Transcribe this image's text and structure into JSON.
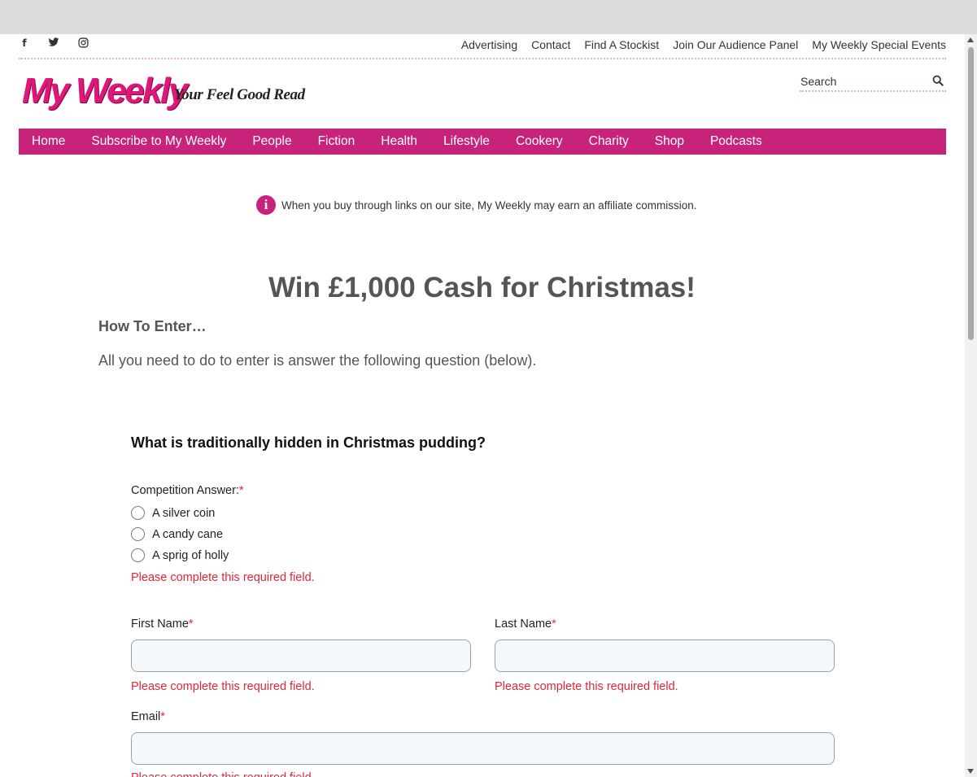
{
  "social": {
    "facebook_icon": "f",
    "twitter_icon": "twitter-bird",
    "instagram_icon": "instagram"
  },
  "toplinks": [
    "Advertising",
    "Contact",
    "Find A Stockist",
    "Join Our Audience Panel",
    "My Weekly Special Events"
  ],
  "brand": {
    "logo": "My Weekly",
    "tagline": "Your Feel Good Read",
    "accent_color": "#c8237b"
  },
  "search": {
    "placeholder": "Search"
  },
  "nav": [
    "Home",
    "Subscribe to My Weekly",
    "People",
    "Fiction",
    "Health",
    "Lifestyle",
    "Cookery",
    "Charity",
    "Shop",
    "Podcasts"
  ],
  "notice": {
    "icon": "i",
    "text": "When you buy through links on our site, My Weekly may earn an affiliate commission."
  },
  "article": {
    "title": "Win £1,000 Cash for Christmas!",
    "subheading": "How To Enter…",
    "intro": "All you need to do to enter is answer the following question (below)."
  },
  "form": {
    "question": "What is traditionally hidden in Christmas pudding?",
    "answer_label": "Competition Answer:",
    "required_mark": "*",
    "options": [
      "A silver coin",
      "A candy cane",
      "A sprig of holly"
    ],
    "error": "Please complete this required field.",
    "first_name_label": "First Name",
    "last_name_label": "Last Name",
    "email_label": "Email"
  }
}
